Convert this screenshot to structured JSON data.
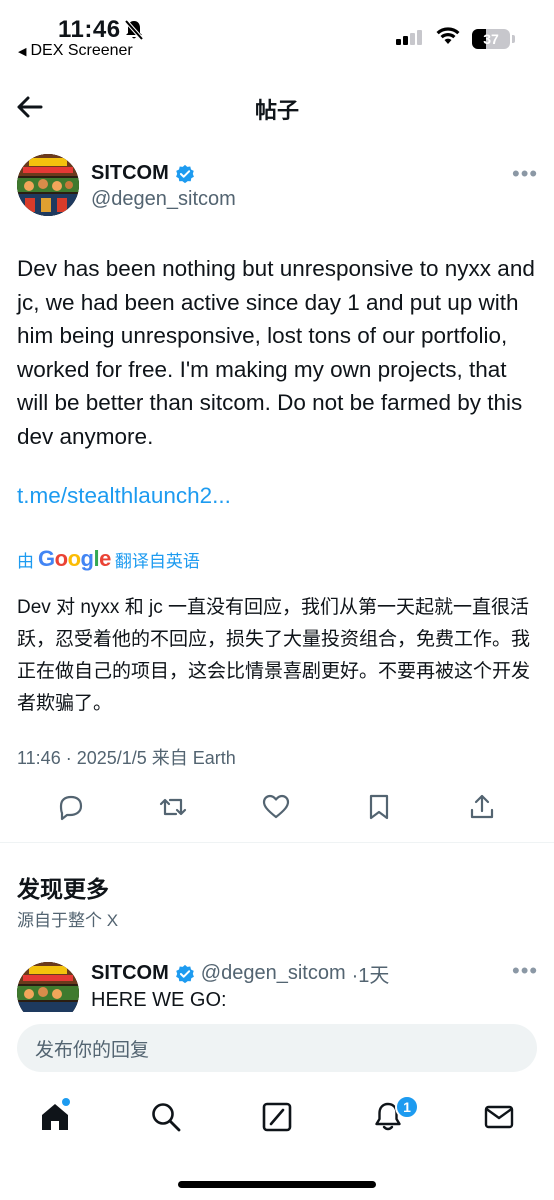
{
  "status_bar": {
    "time": "11:46",
    "back_app": "DEX Screener",
    "battery": "37",
    "icons": [
      "bell-slash-icon",
      "signal-icon",
      "wifi-icon",
      "battery-icon"
    ]
  },
  "nav": {
    "title": "帖子",
    "back_icon": "arrow-left-icon"
  },
  "post": {
    "author_name": "SITCOM",
    "author_handle": "@degen_sitcom",
    "more": "•••",
    "text": "Dev has been nothing but unresponsive to nyxx and jc, we had been active since day 1 and put up with him being unresponsive, lost tons of our portfolio, worked for free. I'm making my own projects, that will be better than sitcom. Do not be farmed by this dev anymore.",
    "link": "t.me/stealthlaunch2...",
    "translation_prefix": "由",
    "translation_brand": "Google",
    "translation_suffix": "翻译自英语",
    "translation": "Dev 对 nyxx 和 jc 一直没有回应，我们从第一天起就一直很活跃，忍受着他的不回应，损失了大量投资组合，免费工作。我正在做自己的项目，这会比情景喜剧更好。不要再被这个开发者欺骗了。",
    "meta": "11:46 · 2025/1/5 来自 Earth",
    "actions": [
      "reply-icon",
      "repost-icon",
      "like-icon",
      "bookmark-icon",
      "share-icon"
    ]
  },
  "discover": {
    "title": "发现更多",
    "subtitle": "源自于整个 X"
  },
  "second_post": {
    "author_name": "SITCOM",
    "author_handle": "@degen_sitcom",
    "time": "·1天",
    "more": "•••",
    "text": "HERE WE GO:"
  },
  "reply": {
    "placeholder": "发布你的回复"
  },
  "tabbar": {
    "tabs": [
      "home-icon",
      "search-icon",
      "grok-icon",
      "notifications-icon",
      "messages-icon"
    ],
    "notification_count": "1"
  },
  "colors": {
    "accent": "#1d9bf0",
    "text": "#0f1419",
    "secondary": "#536471"
  }
}
